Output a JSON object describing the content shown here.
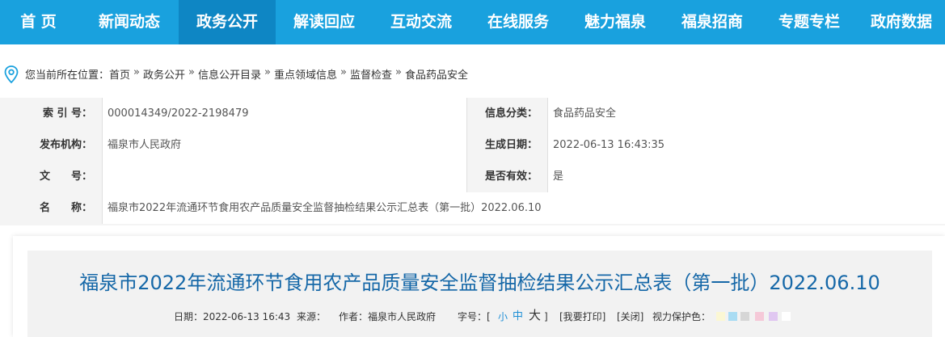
{
  "nav": {
    "items": [
      {
        "label": "首 页"
      },
      {
        "label": "新闻动态"
      },
      {
        "label": "政务公开"
      },
      {
        "label": "解读回应"
      },
      {
        "label": "互动交流"
      },
      {
        "label": "在线服务"
      },
      {
        "label": "魅力福泉"
      },
      {
        "label": "福泉招商"
      },
      {
        "label": "专题专栏"
      },
      {
        "label": "政府数据"
      }
    ],
    "active_index": 2,
    "colors": {
      "bar": "#19a1de",
      "active": "#0e86c4"
    }
  },
  "breadcrumb": {
    "prefix": "您当前所在位置：",
    "items": [
      "首页",
      "政务公开",
      "信息公开目录",
      "重点领域信息",
      "监督检查",
      "食品药品安全"
    ],
    "separator": "»",
    "icon": "location-pin-icon"
  },
  "meta": {
    "index_label": "索 引 号：",
    "index_value": "000014349/2022-2198479",
    "category_label": "信息分类：",
    "category_value": "食品药品安全",
    "publisher_label": "发布机构：",
    "publisher_value": "福泉市人民政府",
    "date_label": "生成日期：",
    "date_value": "2022-06-13 16:43:35",
    "doc_no_label": "文　　号：",
    "doc_no_value": "",
    "valid_label": "是否有效：",
    "valid_value": "是",
    "name_label": "名　　称：",
    "name_value": "福泉市2022年流通环节食用农产品质量安全监督抽检结果公示汇总表（第一批）2022.06.10"
  },
  "article": {
    "title": "福泉市2022年流通环节食用农产品质量安全监督抽检结果公示汇总表（第一批）2022.06.10",
    "date_text": "日期：2022-06-13 16:43",
    "source_text": "来源：",
    "author_text": "作者：福泉市人民政府",
    "font_size_label": "字号：[",
    "font_small": "小",
    "font_medium": "中",
    "font_large": "大",
    "font_close": "]",
    "print_link": "[我要打印]",
    "close_link": "[关闭]",
    "eye_care_label": "视力保护色：",
    "eye_care_colors": [
      "#fbf7d4",
      "#a9dcf3",
      "#d6d6d6",
      "#f5c9d8",
      "#e0c7f1",
      "#ffffff"
    ],
    "title_color": "#1668a8"
  }
}
